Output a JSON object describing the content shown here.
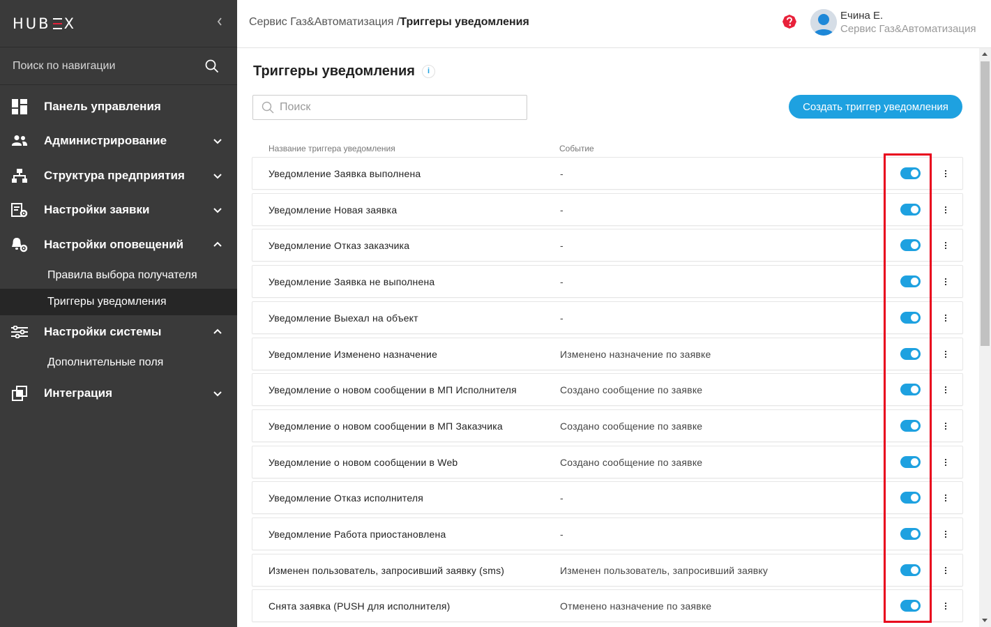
{
  "sidebar": {
    "logo": {
      "part1": "HUB",
      "part2": "X"
    },
    "search_placeholder": "Поиск по навигации",
    "items": [
      {
        "label": "Панель управления",
        "icon": "dashboard-icon",
        "chevron": ""
      },
      {
        "label": "Администрирование",
        "icon": "users-icon",
        "chevron": "down"
      },
      {
        "label": "Структура предприятия",
        "icon": "org-structure-icon",
        "chevron": "down"
      },
      {
        "label": "Настройки заявки",
        "icon": "request-settings-icon",
        "chevron": "down"
      },
      {
        "label": "Настройки оповещений",
        "icon": "notification-settings-icon",
        "chevron": "up"
      },
      {
        "label": "Настройки системы",
        "icon": "system-settings-icon",
        "chevron": "up"
      },
      {
        "label": "Интеграция",
        "icon": "integration-icon",
        "chevron": "down"
      }
    ],
    "notification_sub": [
      "Правила выбора получателя",
      "Триггеры уведомления"
    ],
    "system_sub": [
      "Дополнительные поля"
    ]
  },
  "header": {
    "breadcrumb_parent": "Сервис Газ&Автоматизация /",
    "breadcrumb_current": "Триггеры уведомления",
    "user_name": "Ечина Е.",
    "user_org": "Сервис Газ&Автоматизация"
  },
  "main": {
    "title": "Триггеры уведомления",
    "info_glyph": "i",
    "search_placeholder": "Поиск",
    "create_button": "Создать триггер уведомления",
    "col_name": "Название триггера уведомления",
    "col_event": "Событие",
    "rows": [
      {
        "name": "Уведомление Заявка выполнена",
        "event": "-",
        "enabled": true
      },
      {
        "name": "Уведомление Новая заявка",
        "event": "-",
        "enabled": true
      },
      {
        "name": "Уведомление Отказ заказчика",
        "event": "-",
        "enabled": true
      },
      {
        "name": "Уведомление Заявка не выполнена",
        "event": "-",
        "enabled": true
      },
      {
        "name": "Уведомление Выехал на объект",
        "event": "-",
        "enabled": true
      },
      {
        "name": "Уведомление Изменено назначение",
        "event": "Изменено назначение по заявке",
        "enabled": true
      },
      {
        "name": "Уведомление о новом сообщении в МП Исполнителя",
        "event": "Создано сообщение по заявке",
        "enabled": true
      },
      {
        "name": "Уведомление о новом сообщении в МП Заказчика",
        "event": "Создано сообщение по заявке",
        "enabled": true
      },
      {
        "name": "Уведомление о новом сообщении в Web",
        "event": "Создано сообщение по заявке",
        "enabled": true
      },
      {
        "name": "Уведомление Отказ исполнителя",
        "event": "-",
        "enabled": true
      },
      {
        "name": "Уведомление Работа приостановлена",
        "event": "-",
        "enabled": true
      },
      {
        "name": "Изменен пользователь, запросивший заявку (sms)",
        "event": "Изменен пользователь, запросивший заявку",
        "enabled": true
      },
      {
        "name": "Снята заявка (PUSH для исполнителя)",
        "event": "Отменено назначение по заявке",
        "enabled": true
      }
    ]
  },
  "colors": {
    "accent": "#1ea1e0",
    "sidebar_bg": "#3a3a3a",
    "highlight": "#e8001c",
    "logo_red": "#e3213a",
    "help_red": "#e8213a"
  }
}
